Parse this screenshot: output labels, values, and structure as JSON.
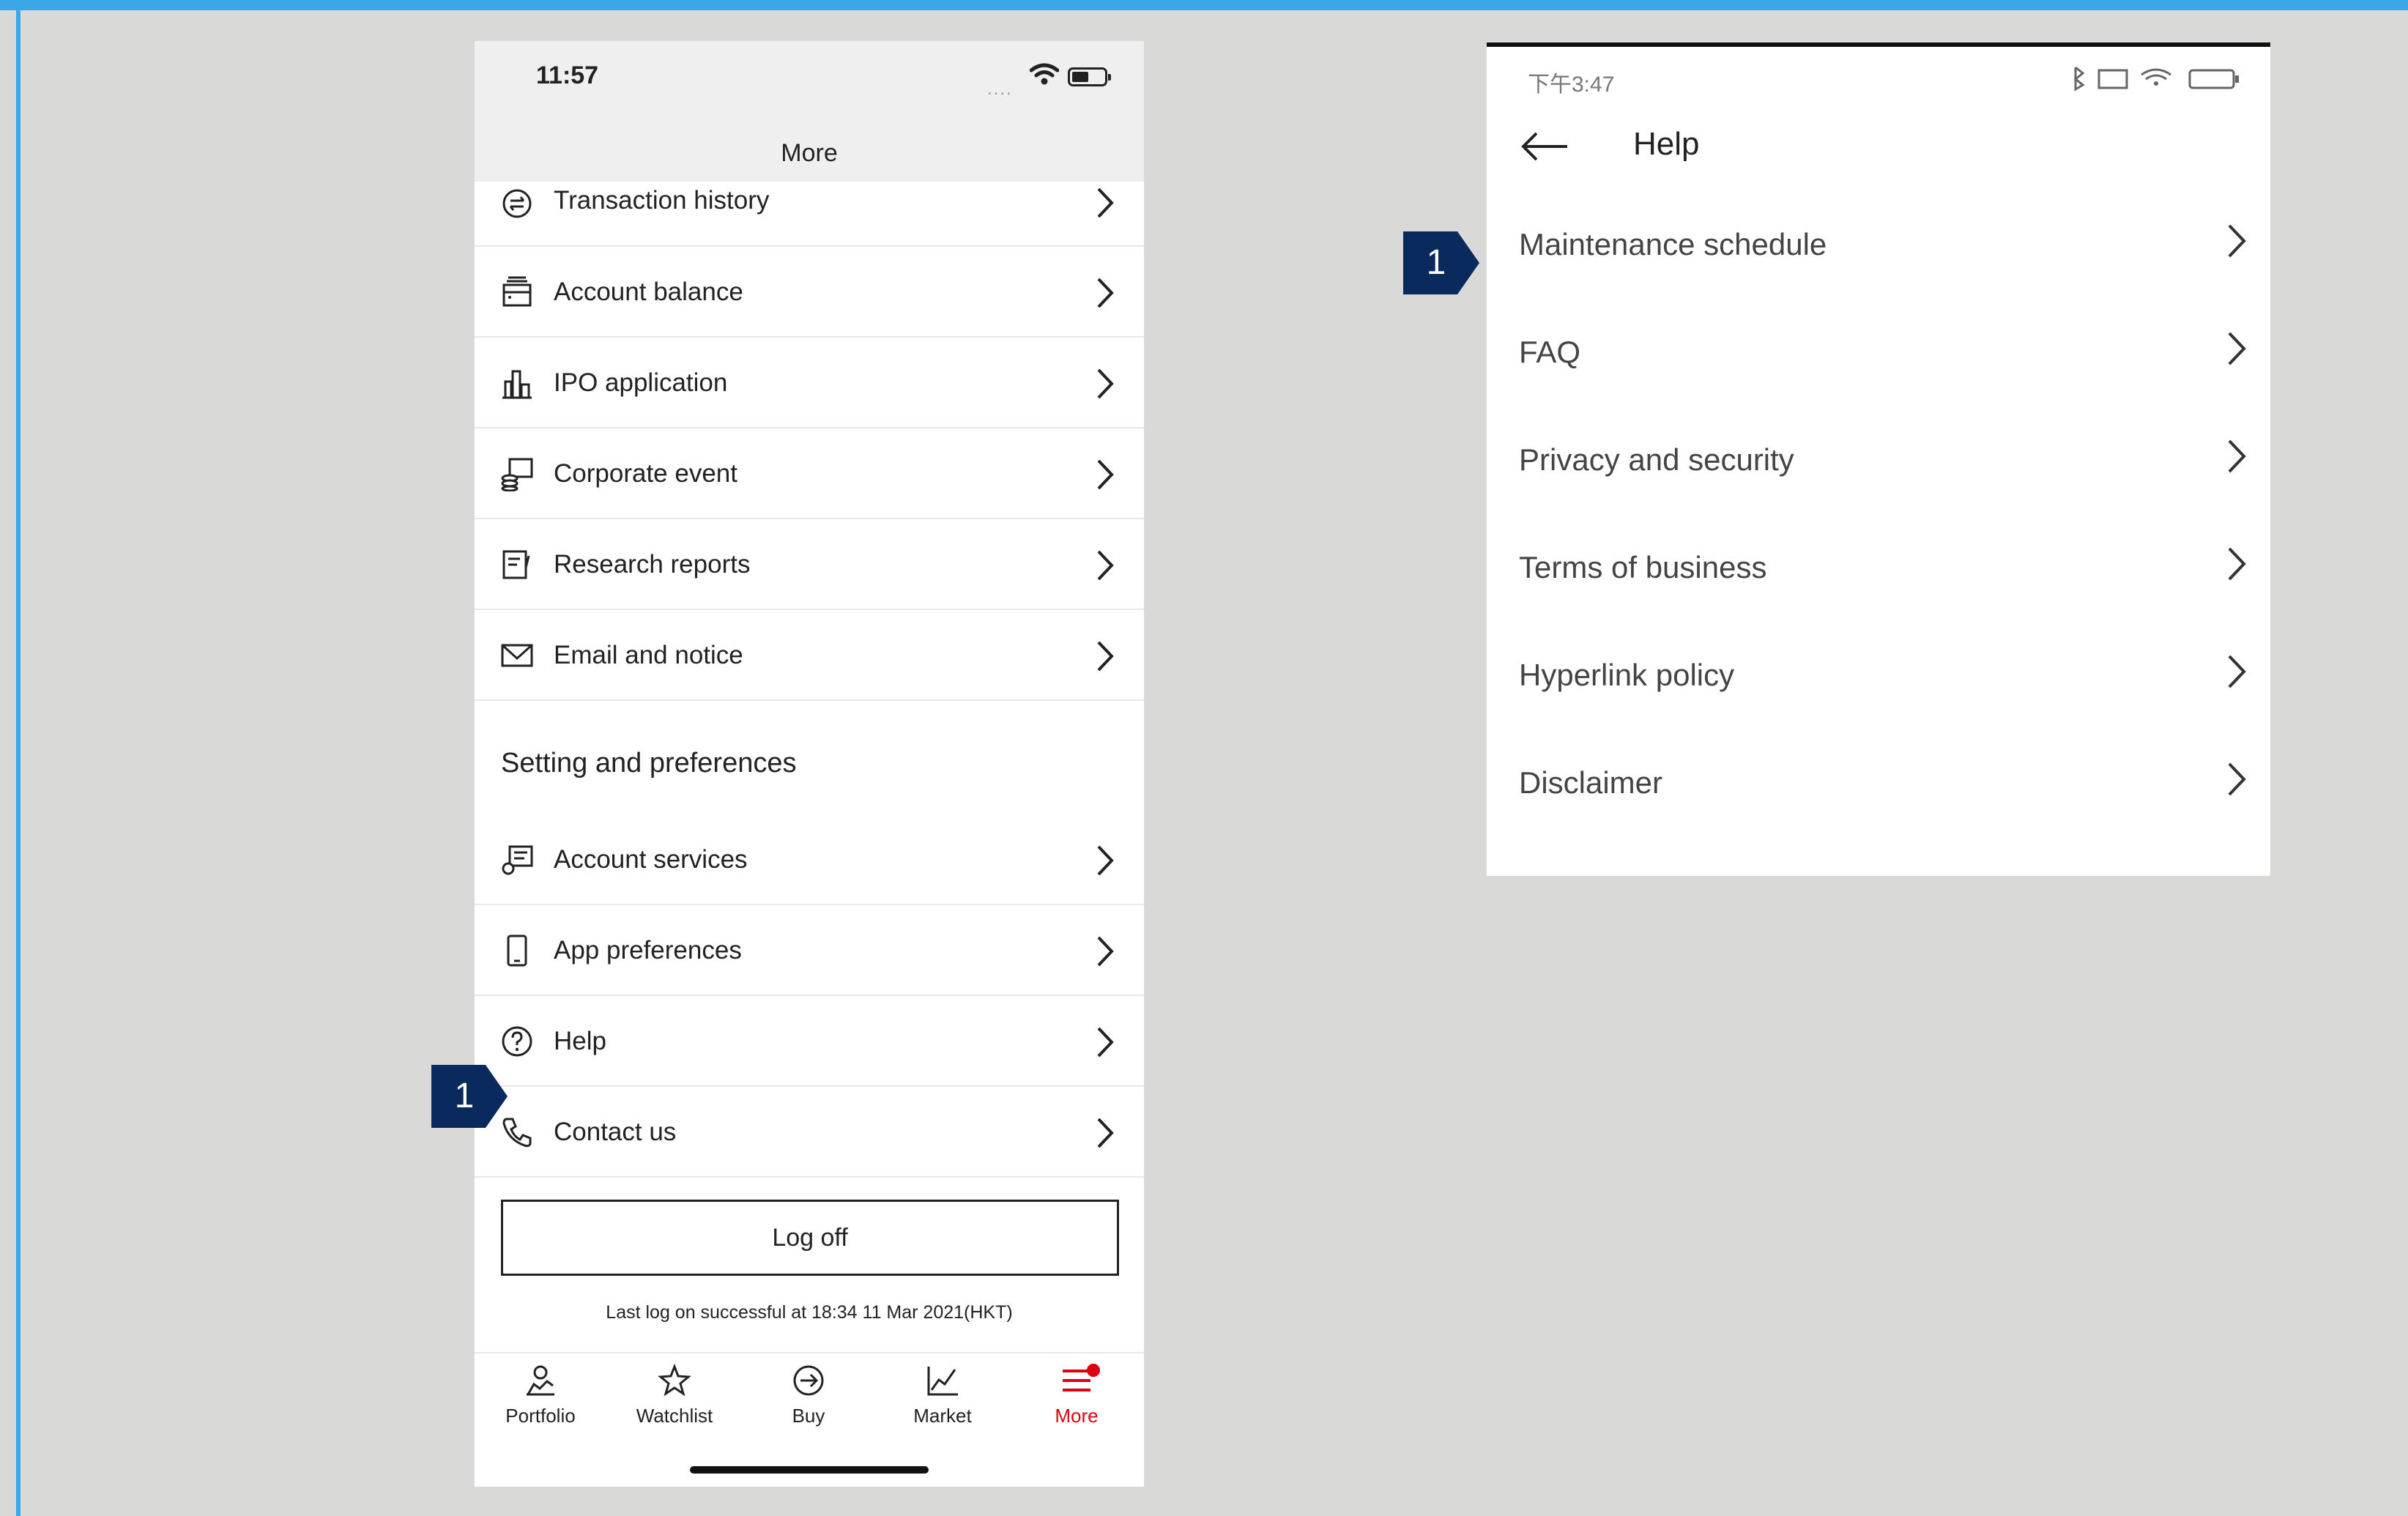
{
  "left_screen": {
    "status_time": "11:57",
    "status_signal": "....",
    "header_title": "More",
    "menu_items": [
      {
        "label": "Transaction history",
        "icon": "transfer-icon"
      },
      {
        "label": "Account balance",
        "icon": "wallet-icon"
      },
      {
        "label": "IPO application",
        "icon": "buildings-icon"
      },
      {
        "label": "Corporate event",
        "icon": "coins-document-icon"
      },
      {
        "label": "Research reports",
        "icon": "report-icon"
      },
      {
        "label": "Email and notice",
        "icon": "mail-icon"
      }
    ],
    "section_title": "Setting and preferences",
    "settings_items": [
      {
        "label": "Account services",
        "icon": "account-services-icon"
      },
      {
        "label": "App preferences",
        "icon": "mobile-icon"
      },
      {
        "label": "Help",
        "icon": "help-circle-icon"
      },
      {
        "label": "Contact us",
        "icon": "phone-icon"
      }
    ],
    "logoff_label": "Log off",
    "last_log": "Last log on successful at 18:34 11 Mar 2021(HKT)",
    "tabs": [
      {
        "label": "Portfolio",
        "icon": "person-chart-icon"
      },
      {
        "label": "Watchlist",
        "icon": "star-icon"
      },
      {
        "label": "Buy",
        "icon": "arrow-circle-icon"
      },
      {
        "label": "Market",
        "icon": "line-chart-icon"
      },
      {
        "label": "More",
        "icon": "menu-icon",
        "active": true
      }
    ],
    "callout": "1"
  },
  "right_screen": {
    "status_left": "下午3:47",
    "header_title": "Help",
    "items": [
      {
        "label": "Maintenance schedule"
      },
      {
        "label": "FAQ"
      },
      {
        "label": "Privacy and security"
      },
      {
        "label": "Terms of business"
      },
      {
        "label": "Hyperlink policy"
      },
      {
        "label": "Disclaimer"
      }
    ],
    "callout": "1"
  },
  "colors": {
    "frame": "#3aa8e6",
    "background": "#d9d9d8",
    "accent_red": "#db0011",
    "callout_navy": "#0a2a5e"
  }
}
